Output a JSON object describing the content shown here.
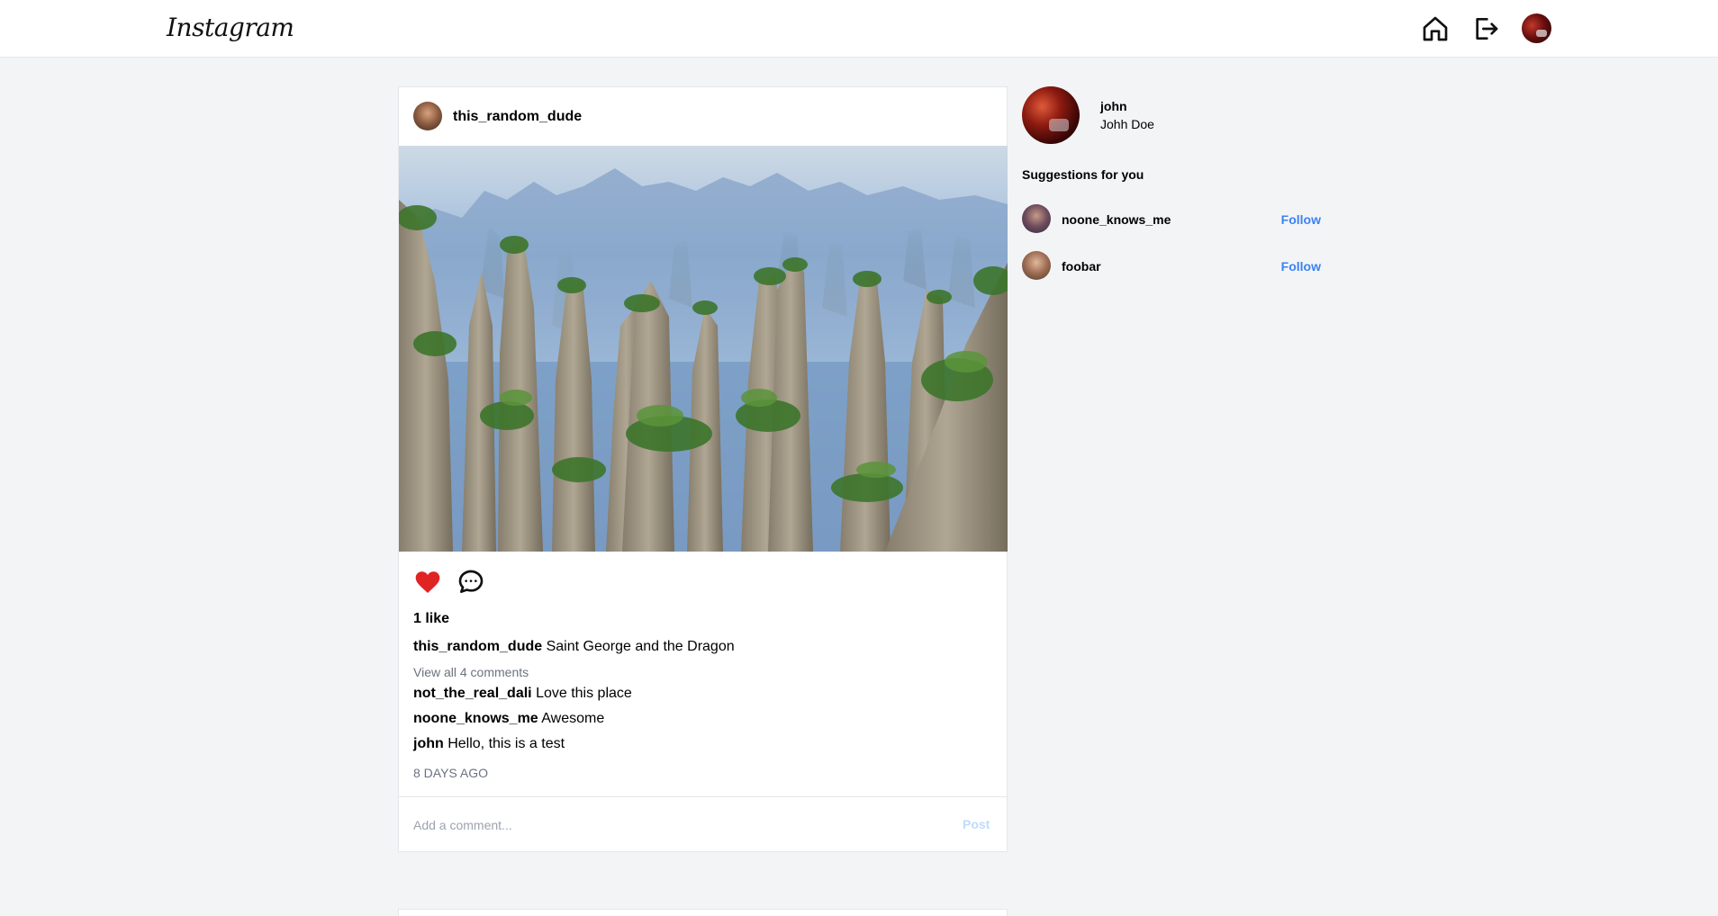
{
  "header": {
    "logo": "Instagram",
    "icons": [
      "home-icon",
      "logout-icon"
    ]
  },
  "post": {
    "username": "this_random_dude",
    "likes": "1 like",
    "caption": {
      "user": "this_random_dude",
      "text": "Saint George and the Dragon"
    },
    "view_all": "View all 4 comments",
    "comments": [
      {
        "user": "not_the_real_dali",
        "text": "Love this place"
      },
      {
        "user": "noone_knows_me",
        "text": "Awesome"
      },
      {
        "user": "john",
        "text": "Hello, this is a test"
      }
    ],
    "time": "8 days ago",
    "comment_placeholder": "Add a comment...",
    "post_label": "Post",
    "liked": true,
    "like_color": "#e02424"
  },
  "sidebar": {
    "username": "john",
    "full_name": "Johh Doe",
    "suggestions_title": "Suggestions for you",
    "suggestions": [
      {
        "username": "noone_knows_me",
        "follow_label": "Follow"
      },
      {
        "username": "foobar",
        "follow_label": "Follow"
      }
    ],
    "accent": "#3b82f6"
  }
}
